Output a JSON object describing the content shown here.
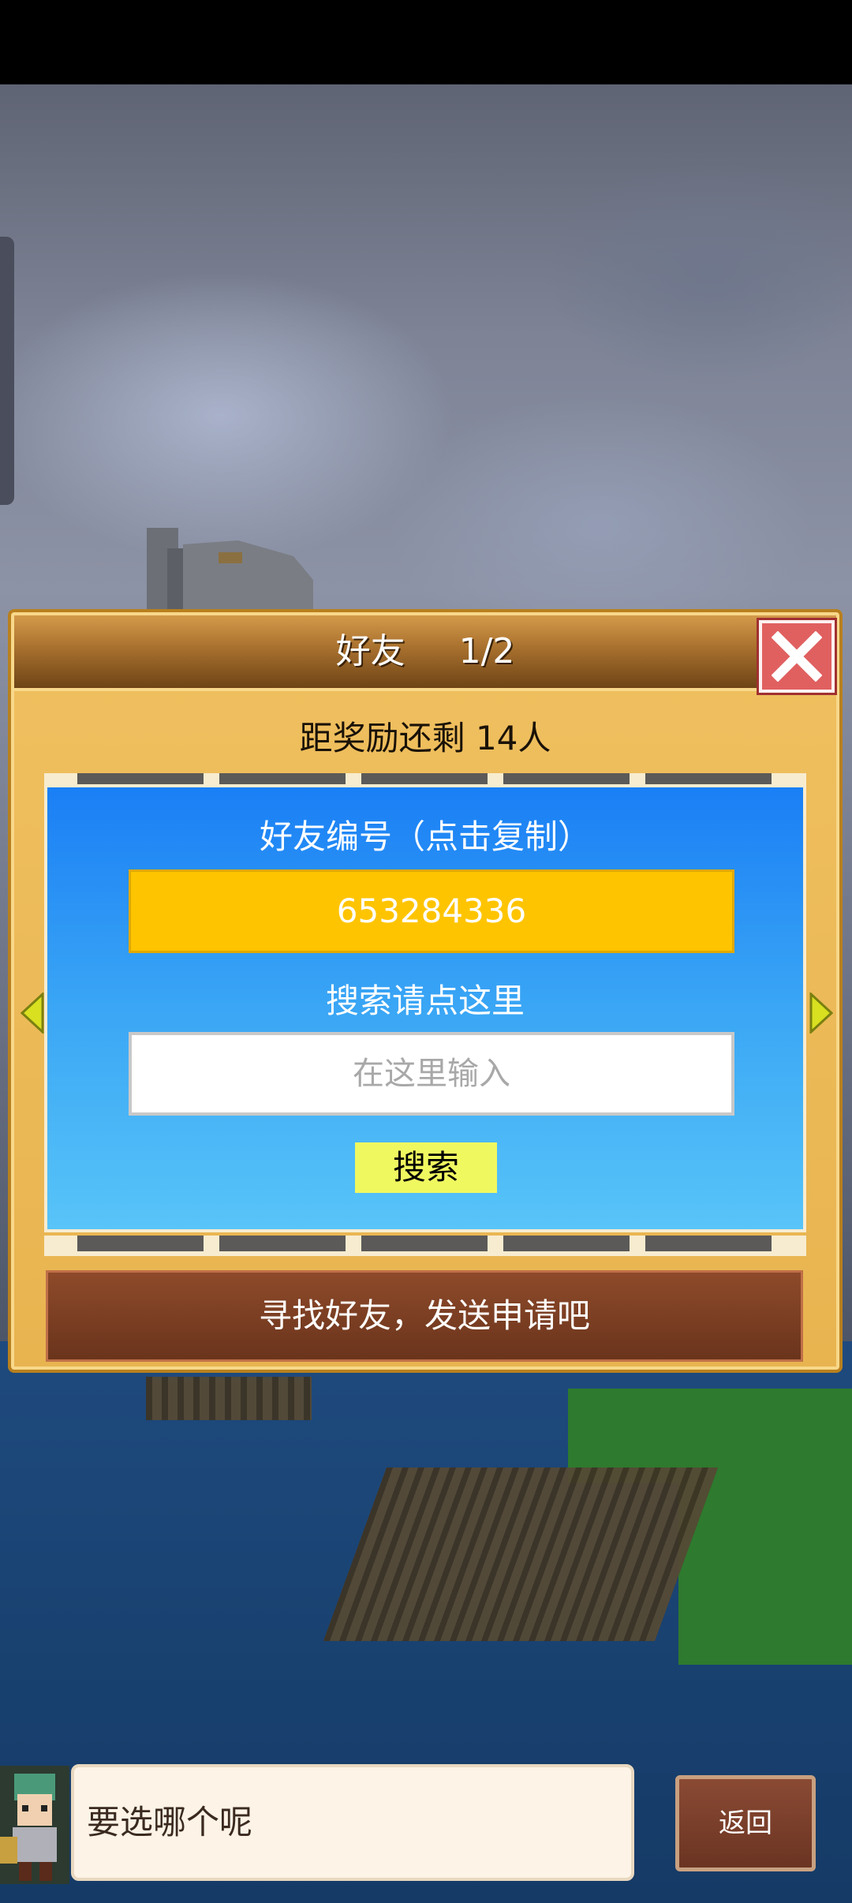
{
  "header": {
    "title": "好友",
    "page": "1/2"
  },
  "reward": {
    "text": "距奖励还剩 14人"
  },
  "friend_id": {
    "label": "好友编号（点击复制）",
    "value": "653284336"
  },
  "search": {
    "label": "搜索请点这里",
    "placeholder": "在这里输入",
    "button_label": "搜索"
  },
  "find_friends": {
    "label": "寻找好友，发送申请吧"
  },
  "dialog": {
    "text": "要选哪个呢",
    "back_label": "返回"
  },
  "colors": {
    "panel": "#f0c060",
    "id_box": "#ffc400",
    "search_button": "#f0f860",
    "close_button": "#e06060"
  }
}
